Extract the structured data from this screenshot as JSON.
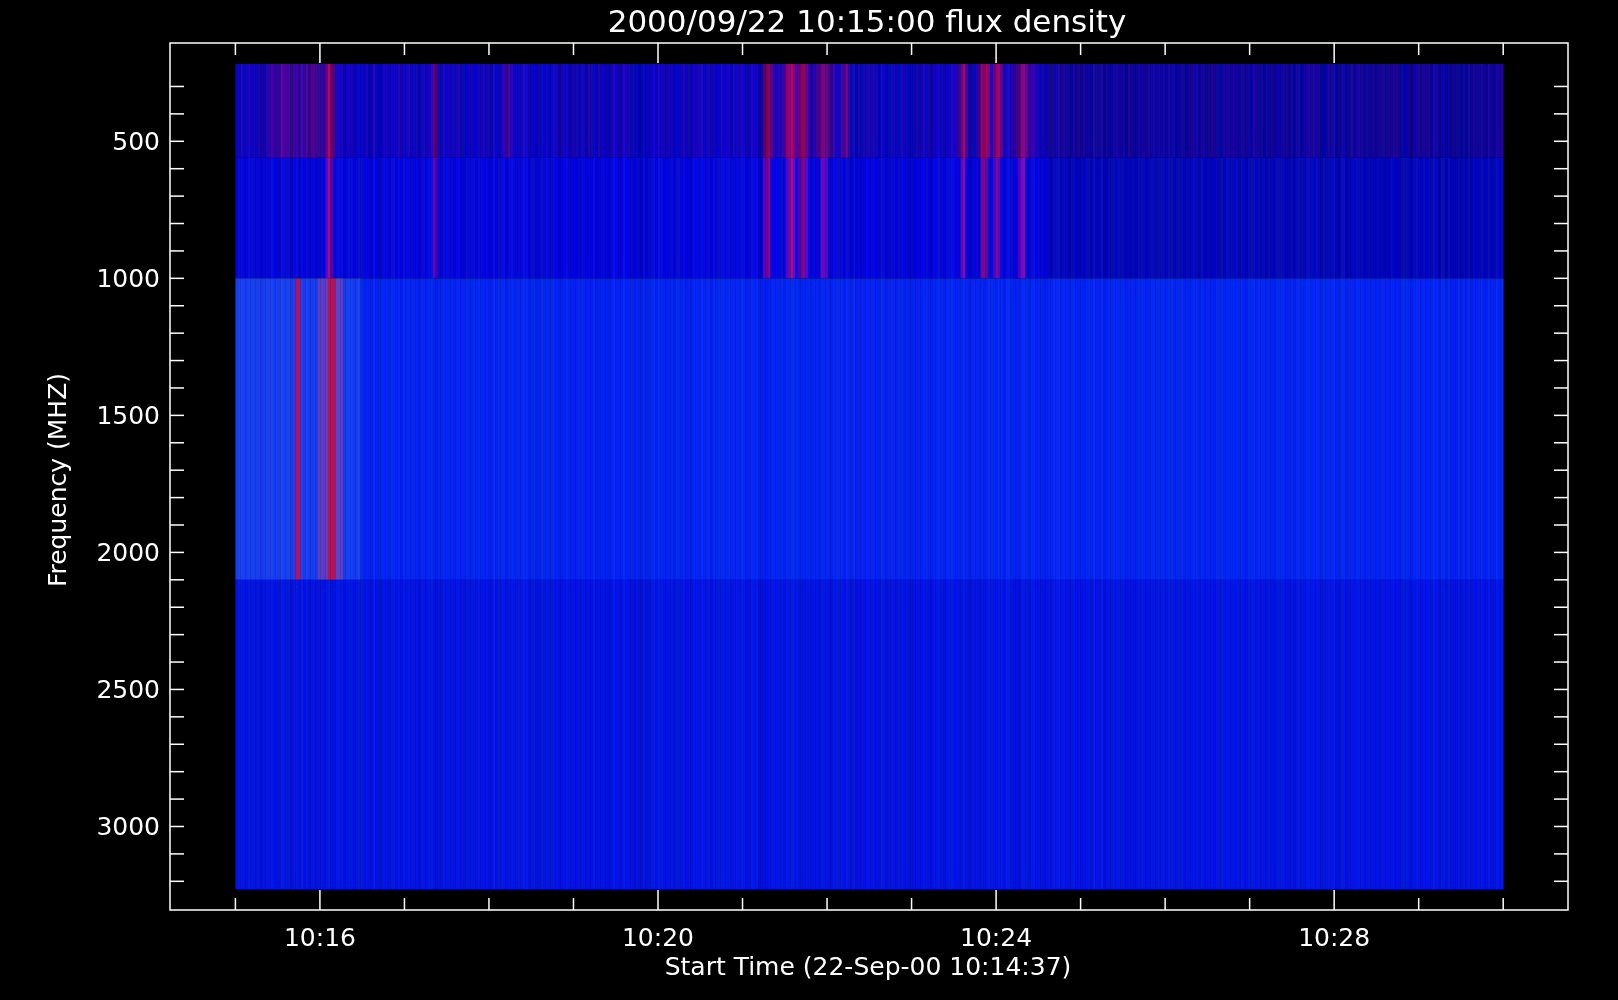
{
  "title": "2000/09/22 10:15:00 flux density",
  "y_axis": {
    "label": "Frequency (MHZ)",
    "ticks": [
      "500",
      "1000",
      "1500",
      "2000",
      "2500",
      "3000"
    ]
  },
  "x_axis": {
    "label": "Start Time (22-Sep-00 10:14:37)",
    "ticks": [
      "10:16",
      "10:20",
      "10:24",
      "10:28"
    ]
  }
}
